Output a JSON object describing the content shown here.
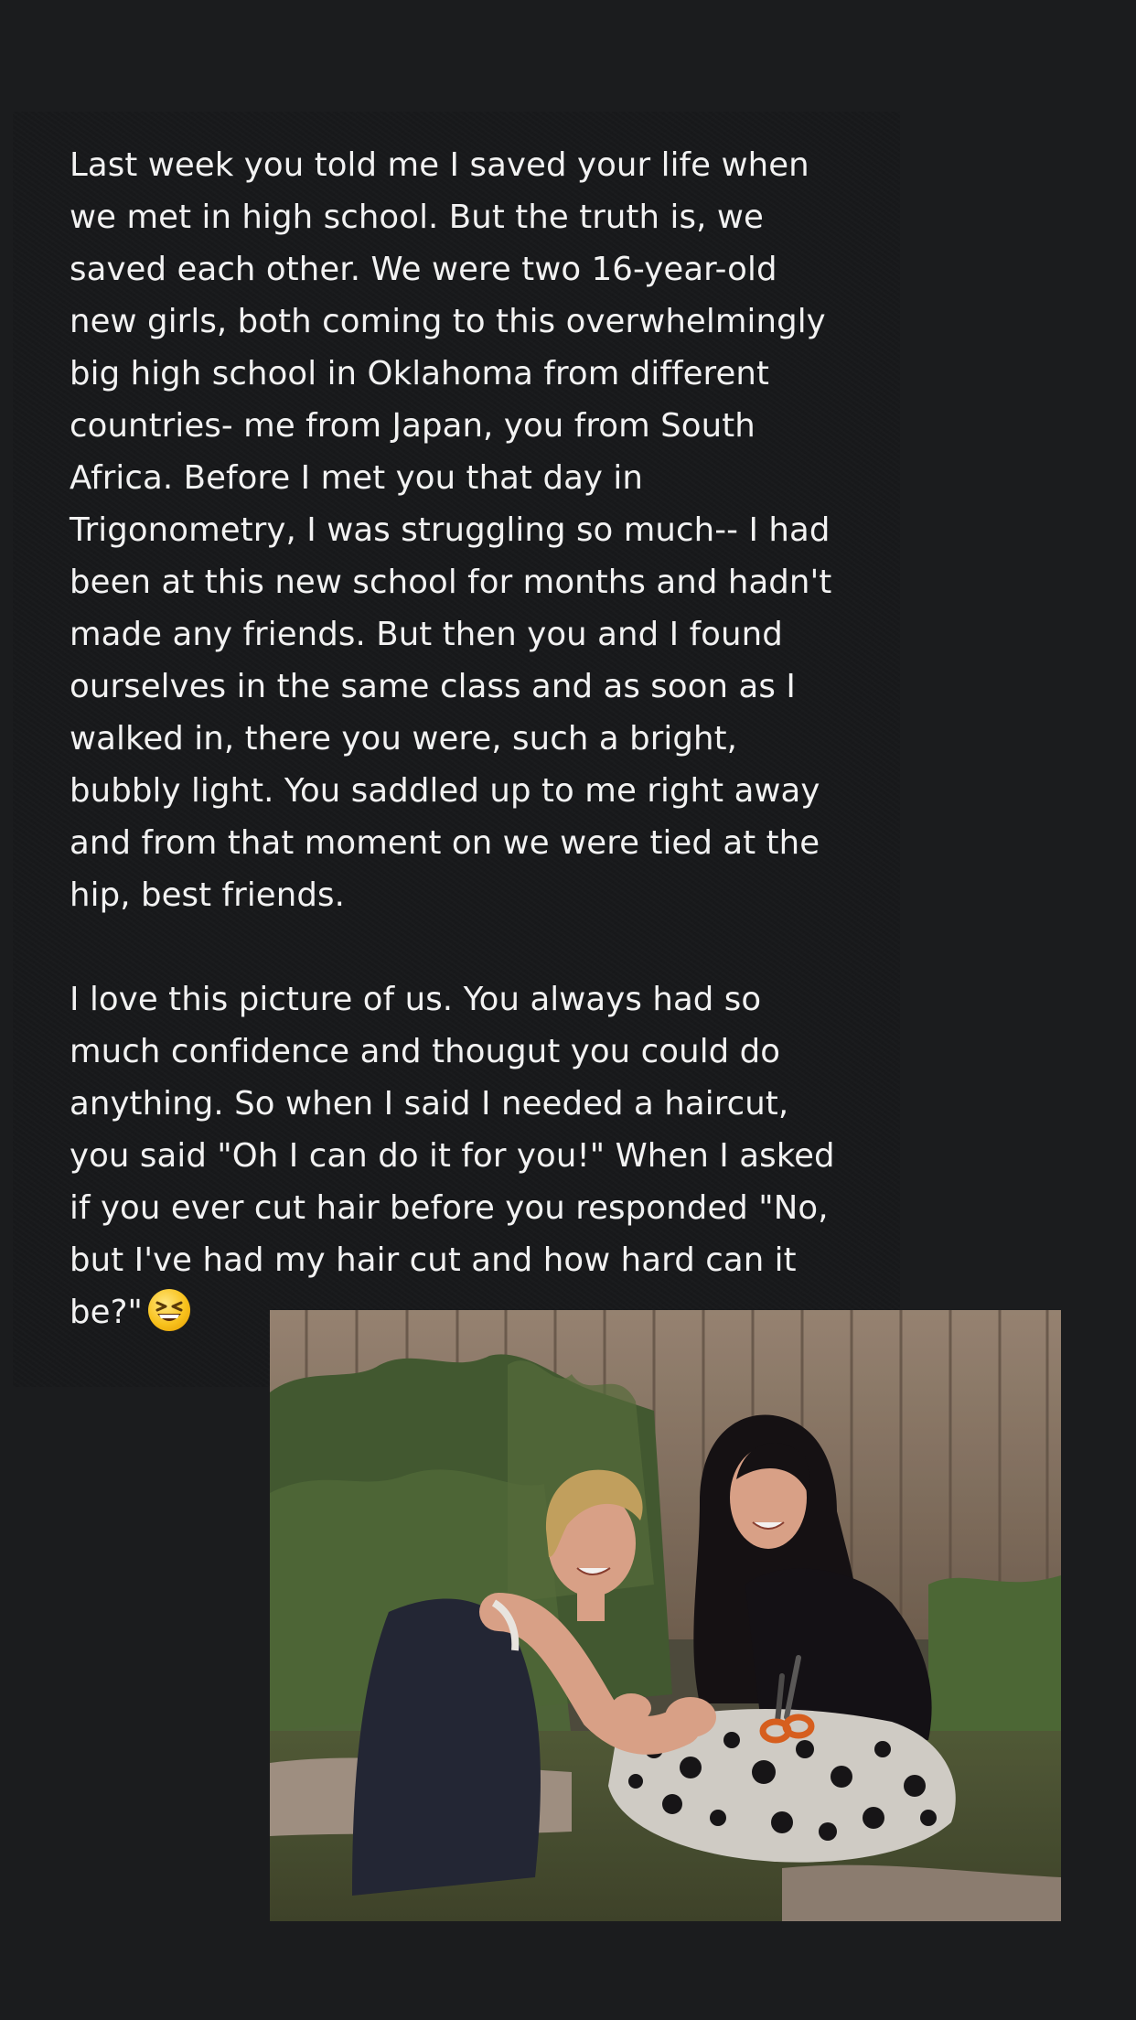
{
  "story": {
    "paragraphs": [
      {
        "lines": [
          "Last week you told me I saved your life when",
          "we met in high school. But the truth is, we",
          "saved each other. We were two 16-year-old",
          "new girls, both coming to this overwhelmingly",
          "big high school in Oklahoma from different",
          "countries- me from Japan, you from South",
          "Africa. Before I met you that day in",
          "Trigonometry, I was struggling so much-- I had",
          "been at this new school for months and hadn't",
          "made any friends. But then you and I found",
          "ourselves in the same class and as soon as I",
          "walked in, there you were, such a bright,",
          "bubbly light. You saddled up to me right away",
          "and from that moment on we were tied at the",
          "hip, best friends."
        ]
      },
      {
        "lines": [
          "I love this picture of us. You always had so",
          "much confidence and thougut you could do",
          "anything. So when I said I needed a haircut,",
          "you said \"Oh I can do it for you!\" When I asked",
          "if you ever cut hair before you responded \"No,",
          "but I've had my hair cut and how hard can it",
          "be?\""
        ]
      }
    ],
    "emoji": "grinning-squinting-face-icon"
  },
  "photo": {
    "icon": "photo-two-friends-haircut",
    "colors": {
      "fence": "#8c7a68",
      "foliage": "#3f5a2f",
      "hair_dark": "#0f0c10",
      "hair_blonde": "#c9a760",
      "skin": "#e2a88c",
      "top_navy": "#1e2333",
      "scissors": "#e0601c"
    }
  },
  "colors": {
    "background": "#1b1c1e",
    "card": "#18191b",
    "text": "#f2f2f2"
  }
}
